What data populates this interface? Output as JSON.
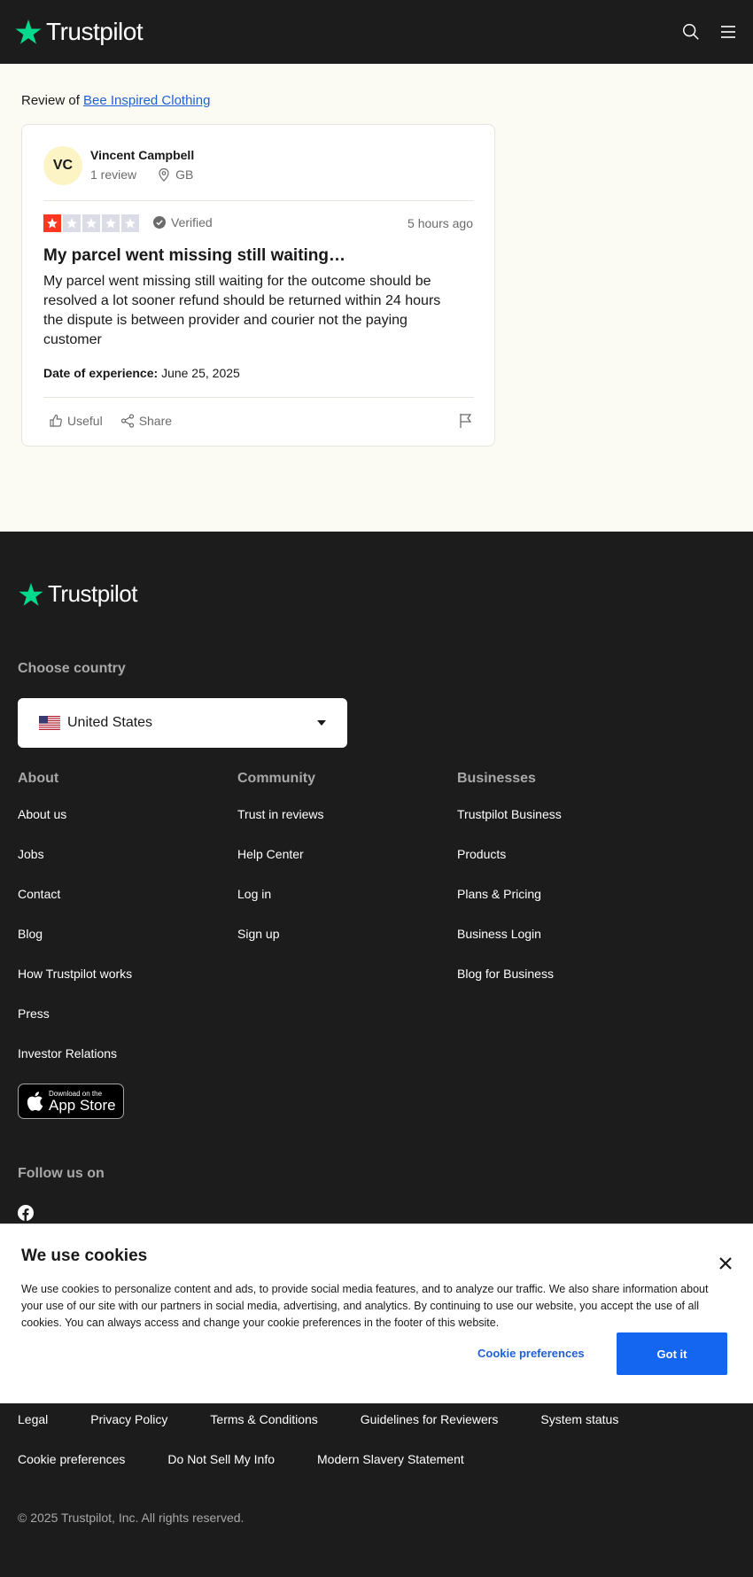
{
  "header": {
    "logo_text": "Trustpilot",
    "brand_color": "#04da8d"
  },
  "review": {
    "review_of_label": "Review of",
    "business_name": "Bee Inspired Clothing",
    "consumer": {
      "initials": "VC",
      "name": "Vincent Campbell",
      "review_count": "1 review",
      "country": "GB"
    },
    "rating": 1,
    "rating_max": 5,
    "rating_color": "#ff3722",
    "verified_label": "Verified",
    "time": "5 hours ago",
    "title": "My parcel went missing still waiting…",
    "body": "My parcel went missing still waiting for the outcome should be resolved a lot sooner refund should be returned within 24 hours the dispute is between provider and courier not the paying customer",
    "experience_label": "Date of experience:",
    "experience_date": "June 25, 2025",
    "useful_label": "Useful",
    "share_label": "Share"
  },
  "footer": {
    "logo_text": "Trustpilot",
    "choose_country_label": "Choose country",
    "country_selected": "United States",
    "about": {
      "heading": "About",
      "links": [
        "About us",
        "Jobs",
        "Contact",
        "Blog",
        "How Trustpilot works",
        "Press",
        "Investor Relations"
      ]
    },
    "community": {
      "heading": "Community",
      "links": [
        "Trust in reviews",
        "Help Center",
        "Log in",
        "Sign up"
      ]
    },
    "businesses": {
      "heading": "Businesses",
      "links": [
        "Trustpilot Business",
        "Products",
        "Plans & Pricing",
        "Business Login",
        "Blog for Business"
      ]
    },
    "app_store_small": "Download on the",
    "app_store_big": "App Store",
    "follow_label": "Follow us on",
    "legal_row_1": [
      "Legal",
      "Privacy Policy",
      "Terms & Conditions",
      "Guidelines for Reviewers",
      "System status"
    ],
    "legal_row_2": [
      "Cookie preferences",
      "Do Not Sell My Info",
      "Modern Slavery Statement"
    ],
    "copyright": "© 2025 Trustpilot, Inc. All rights reserved."
  },
  "cookie": {
    "title": "We use cookies",
    "text": "We use cookies to personalize content and ads, to provide social media features, and to analyze our traffic. We also share information about your use of our site with our partners in social media, advertising, and analytics. By continuing to use our website, you accept the use of all cookies. You can always access and change your cookie preferences in the footer of this website.",
    "preferences_label": "Cookie preferences",
    "accept_label": "Got it",
    "accent_color": "#1465f0"
  }
}
